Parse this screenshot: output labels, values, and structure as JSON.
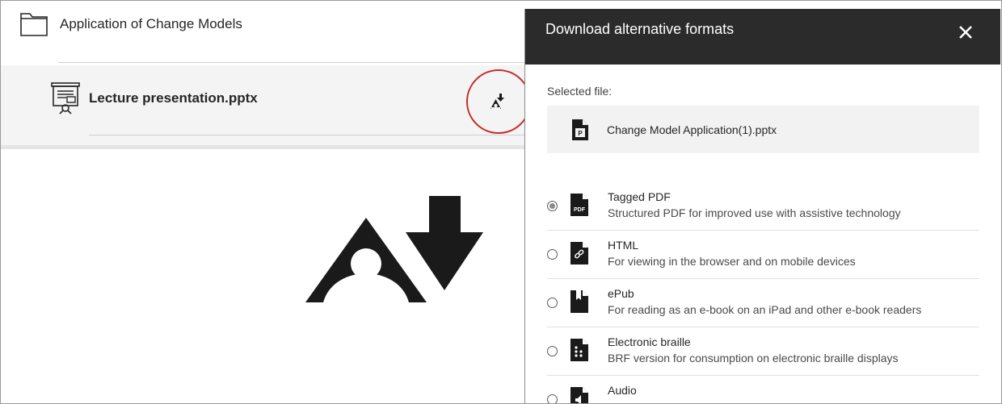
{
  "course": {
    "folder_title": "Application of Change Models",
    "file_name": "Lecture presentation.pptx"
  },
  "panel": {
    "title": "Download alternative formats",
    "selected_label": "Selected file:",
    "selected_file": "Change Model Application(1).pptx",
    "options": [
      {
        "title": "Tagged PDF",
        "desc": "Structured PDF for improved use with assistive technology",
        "checked": true,
        "icon": "pdf-file-icon"
      },
      {
        "title": "HTML",
        "desc": "For viewing in the browser and on mobile devices",
        "checked": false,
        "icon": "html-file-icon"
      },
      {
        "title": "ePub",
        "desc": "For reading as an e-book on an iPad and other e-book readers",
        "checked": false,
        "icon": "epub-file-icon"
      },
      {
        "title": "Electronic braille",
        "desc": "BRF version for consumption on electronic braille displays",
        "checked": false,
        "icon": "braille-file-icon"
      },
      {
        "title": "Audio",
        "desc": "",
        "checked": false,
        "icon": "audio-file-icon"
      }
    ]
  },
  "colors": {
    "panel_header": "#2b2b2b",
    "highlight_circle": "#c62b2b",
    "file_band": "#f4f4f4"
  }
}
